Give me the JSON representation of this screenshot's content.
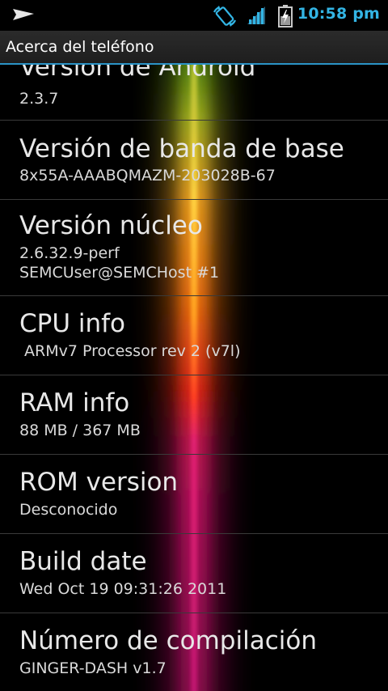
{
  "status_bar": {
    "time": "10:58 pm",
    "icons": [
      "notification-play-icon",
      "rotation-lock-icon",
      "signal-icon",
      "battery-charging-icon"
    ],
    "accent_color": "#33b5e5"
  },
  "title_bar": {
    "title": "Acerca del teléfono",
    "divider_color": "#2b93c6"
  },
  "items": [
    {
      "title": "Versión de Android",
      "summary": "2.3.7"
    },
    {
      "title": "Versión de banda de base",
      "summary": "8x55A-AAABQMAZM-203028B-67"
    },
    {
      "title": "Versión núcleo",
      "summary": "2.6.32.9-perf\nSEMCUser@SEMCHost #1"
    },
    {
      "title": "CPU info",
      "summary": " ARMv7 Processor rev 2 (v7l)"
    },
    {
      "title": "RAM info",
      "summary": "88 MB / 367 MB"
    },
    {
      "title": "ROM version",
      "summary": "Desconocido"
    },
    {
      "title": "Build date",
      "summary": "Wed Oct 19 09:31:26 2011"
    },
    {
      "title": "Número de compilación",
      "summary": "GINGER-DASH v1.7"
    }
  ]
}
